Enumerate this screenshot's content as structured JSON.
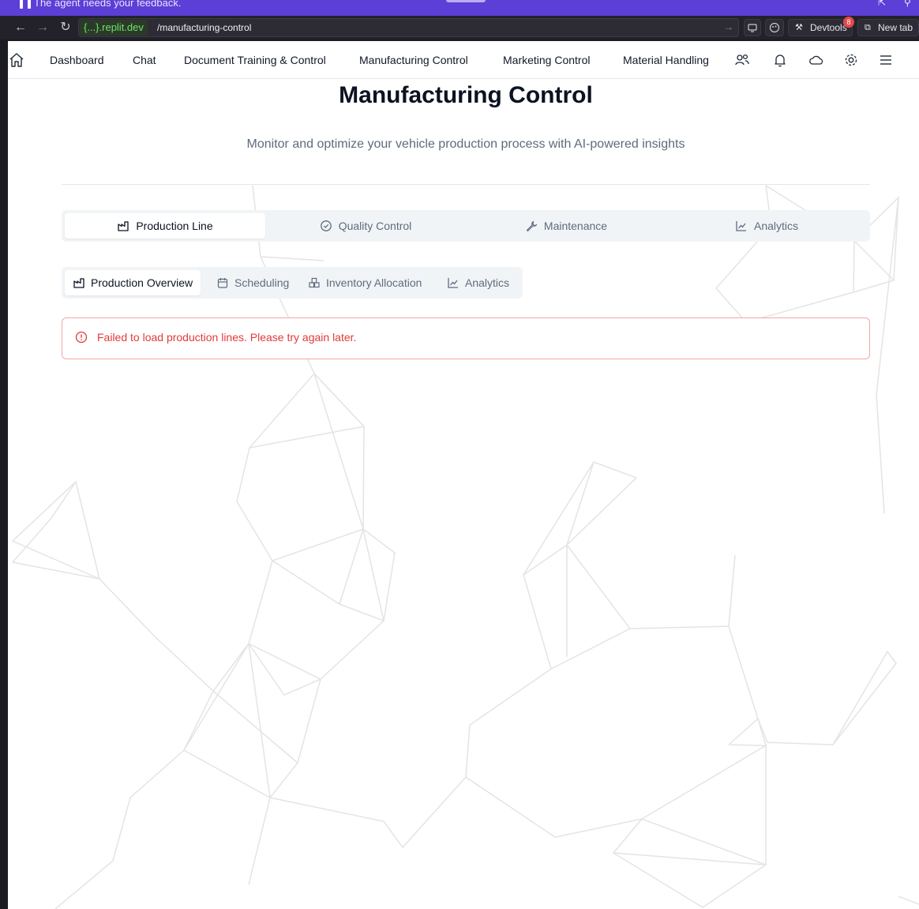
{
  "banner": {
    "text": "The agent needs your feedback."
  },
  "browser": {
    "url_host": "{...}.replit.dev",
    "url_path": "/manufacturing-control",
    "devtools_label": "Devtools",
    "devtools_badge": "8",
    "new_tab_label": "New tab"
  },
  "nav": {
    "items": [
      {
        "label": "Dashboard"
      },
      {
        "label": "Chat"
      },
      {
        "label": "Document Training & Control"
      },
      {
        "label": "Manufacturing Control"
      },
      {
        "label": "Marketing Control"
      },
      {
        "label": "Material Handling"
      }
    ],
    "icons": [
      "home-icon",
      "users-icon",
      "bell-icon",
      "cloud-icon",
      "gear-icon",
      "menu-icon"
    ]
  },
  "page": {
    "title": "Manufacturing Control",
    "subtitle": "Monitor and optimize your vehicle production process with AI-powered insights"
  },
  "main_tabs": [
    {
      "label": "Production Line",
      "icon": "factory-icon",
      "active": true
    },
    {
      "label": "Quality Control",
      "icon": "check-circle-icon",
      "active": false
    },
    {
      "label": "Maintenance",
      "icon": "wrench-icon",
      "active": false
    },
    {
      "label": "Analytics",
      "icon": "line-chart-icon",
      "active": false
    }
  ],
  "sub_tabs": [
    {
      "label": "Production Overview",
      "icon": "factory-icon",
      "active": true
    },
    {
      "label": "Scheduling",
      "icon": "calendar-icon",
      "active": false
    },
    {
      "label": "Inventory Allocation",
      "icon": "boxes-icon",
      "active": false
    },
    {
      "label": "Analytics",
      "icon": "line-chart-icon",
      "active": false
    }
  ],
  "alert": {
    "icon": "alert-circle-icon",
    "message": "Failed to load production lines. Please try again later.",
    "color": "#e23a3a"
  }
}
